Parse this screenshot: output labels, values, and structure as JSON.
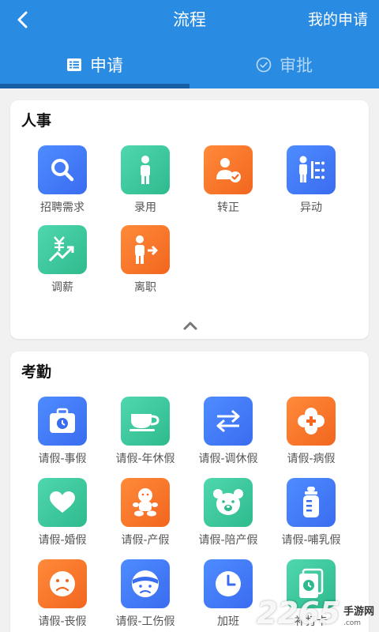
{
  "header": {
    "title": "流程",
    "right_link": "我的申请"
  },
  "tabs": [
    {
      "label": "申请",
      "active": true
    },
    {
      "label": "审批",
      "active": false
    }
  ],
  "hr": {
    "title": "人事",
    "items": [
      {
        "label": "招聘需求",
        "icon": "search-icon",
        "color": "blue"
      },
      {
        "label": "录用",
        "icon": "person-icon",
        "color": "green"
      },
      {
        "label": "转正",
        "icon": "user-check-icon",
        "color": "orange"
      },
      {
        "label": "异动",
        "icon": "transfer-icon",
        "color": "blue"
      },
      {
        "label": "调薪",
        "icon": "yuan-trend-icon",
        "color": "green"
      },
      {
        "label": "离职",
        "icon": "exit-icon",
        "color": "orange"
      }
    ]
  },
  "attendance": {
    "title": "考勤",
    "items": [
      {
        "label": "请假-事假",
        "icon": "briefcase-clock-icon",
        "color": "blue"
      },
      {
        "label": "请假-年休假",
        "icon": "coffee-cup-icon",
        "color": "green"
      },
      {
        "label": "请假-调休假",
        "icon": "swap-arrows-icon",
        "color": "blue"
      },
      {
        "label": "请假-病假",
        "icon": "medical-cross-icon",
        "color": "orange"
      },
      {
        "label": "请假-婚假",
        "icon": "heart-icon",
        "color": "green"
      },
      {
        "label": "请假-产假",
        "icon": "baby-icon",
        "color": "orange"
      },
      {
        "label": "请假-陪产假",
        "icon": "teddy-bear-icon",
        "color": "green"
      },
      {
        "label": "请假-哺乳假",
        "icon": "baby-bottle-icon",
        "color": "blue"
      },
      {
        "label": "请假-丧假",
        "icon": "sad-face-icon",
        "color": "orange"
      },
      {
        "label": "请假-工伤假",
        "icon": "injured-face-icon",
        "color": "blue"
      },
      {
        "label": "加班",
        "icon": "clock-icon",
        "color": "blue"
      },
      {
        "label": "补打卡",
        "icon": "punch-card-icon",
        "color": "green"
      }
    ]
  },
  "watermark": {
    "number": "2265",
    "site": "手游网",
    "domain": ".com"
  }
}
